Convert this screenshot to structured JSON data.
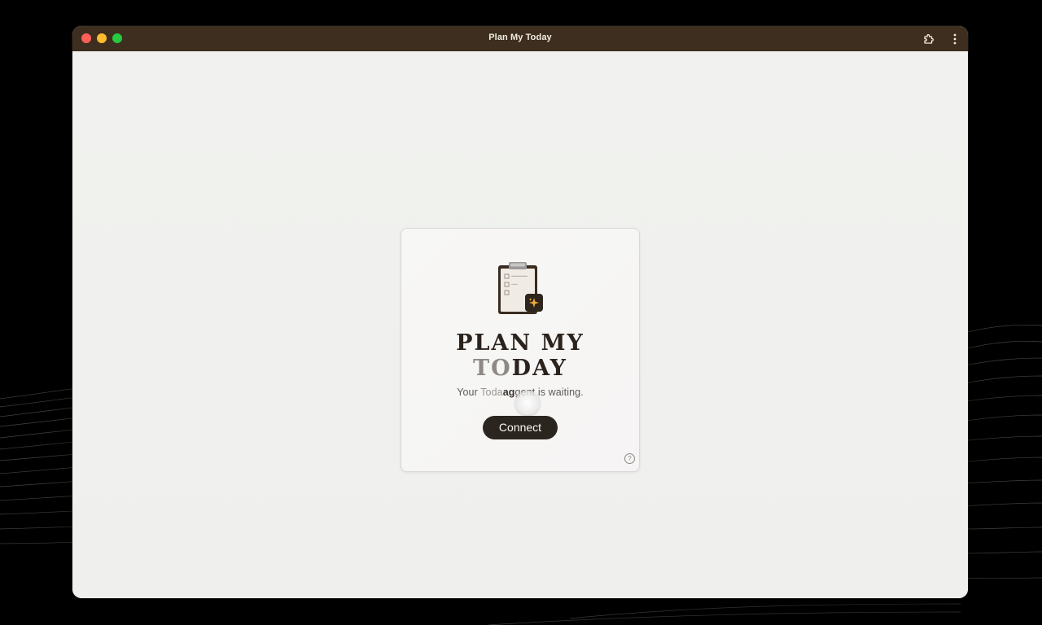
{
  "window": {
    "title": "Plan My Today"
  },
  "titlebar": {
    "icons": [
      "close-dot",
      "minimize-dot",
      "maximize-dot",
      "extension-icon",
      "more-vertical-icon"
    ]
  },
  "card": {
    "headline_line1": "PLAN MY",
    "headline_line2_faded": "TO",
    "headline_line2_rest": "DAY",
    "subtitle_before": "Your ",
    "subtitle_faded": "Toda",
    "subtitle_dark": "ag",
    "subtitle_after": "gent is waiting.",
    "connect_label": "Connect",
    "help_label": "?",
    "logo_icon": "clipboard-sparkle-icon"
  },
  "colors": {
    "titlebar": "#3d2e1f",
    "accent_dark": "#2b2520",
    "sparkle": "#f2a93b",
    "content_bg": "#f0f1ef"
  }
}
